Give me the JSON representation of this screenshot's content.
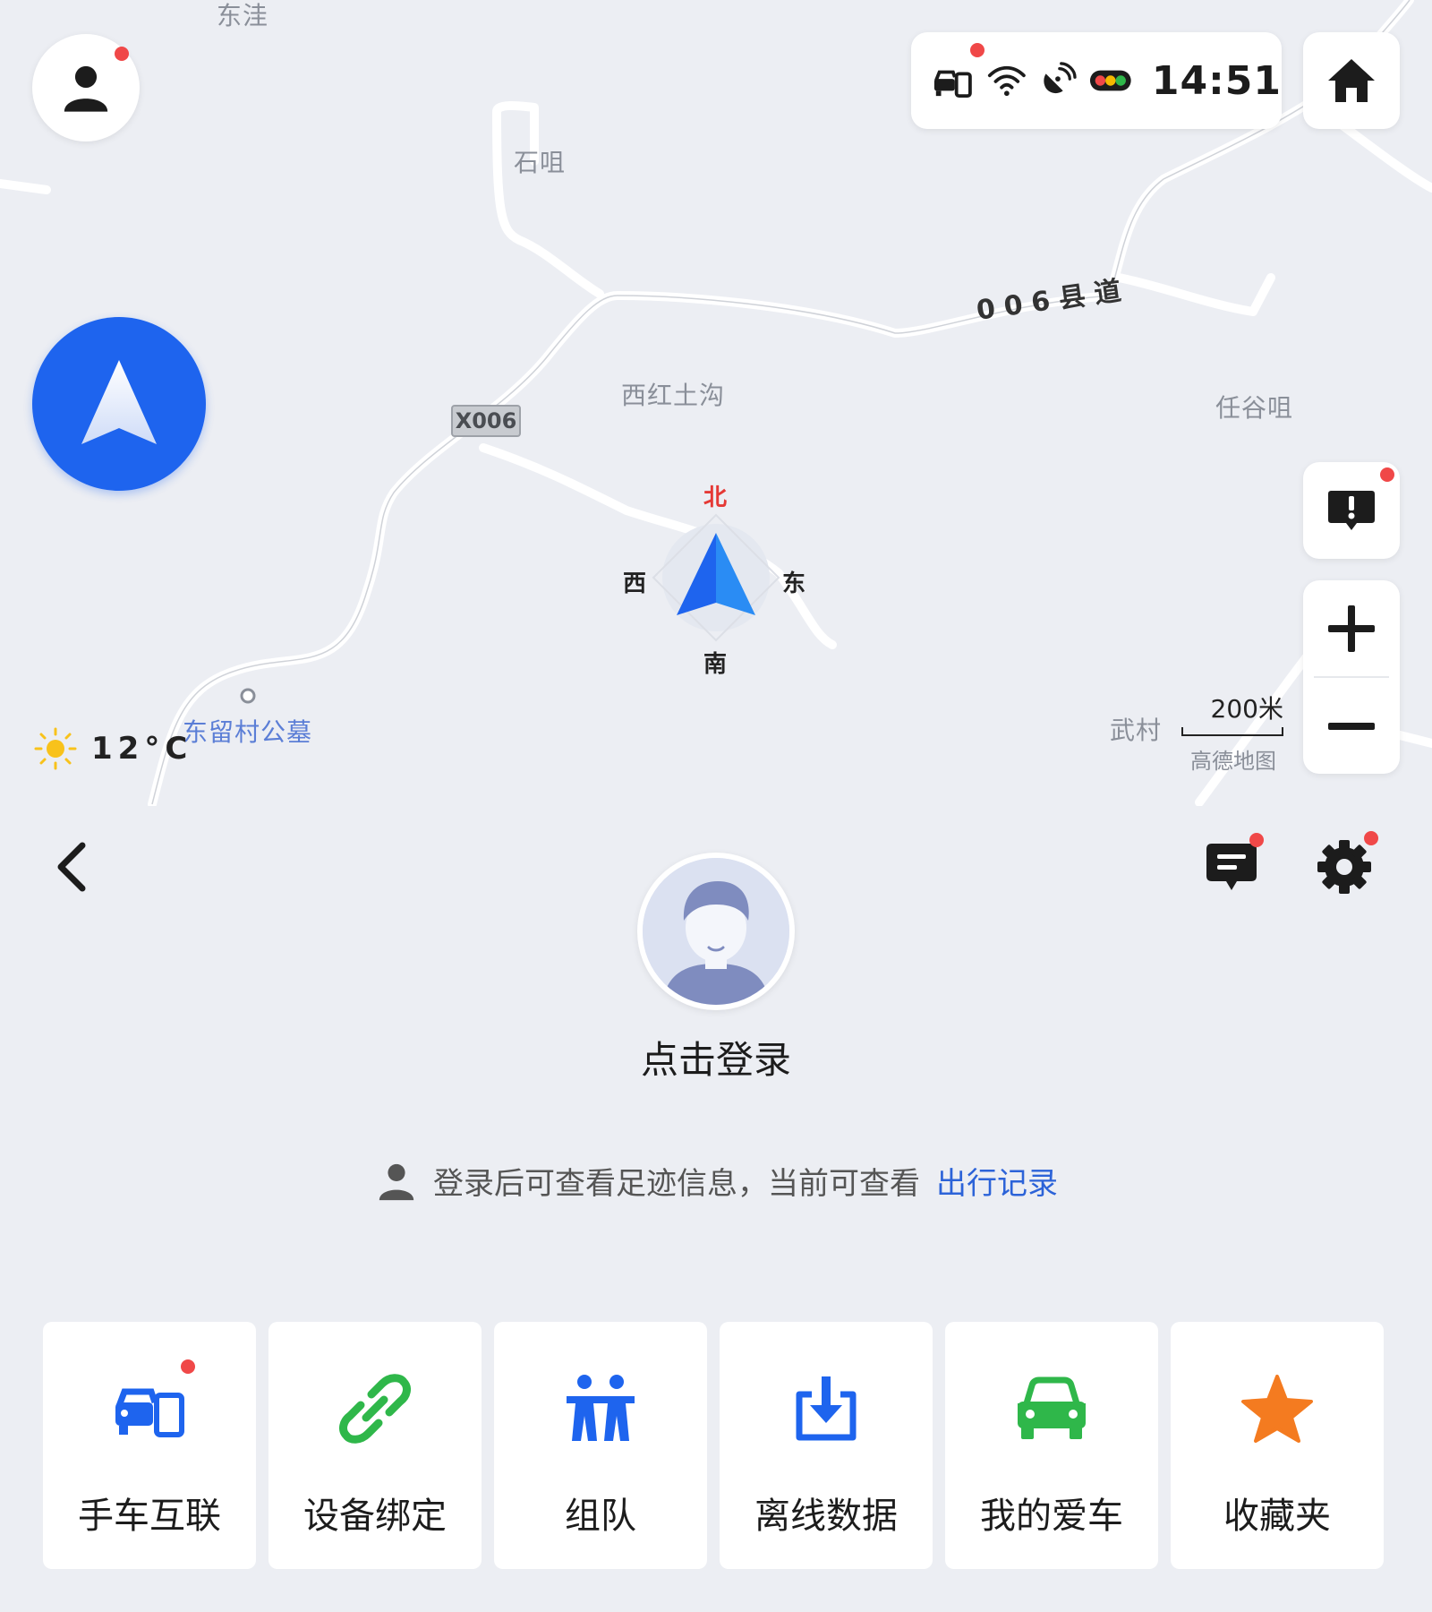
{
  "map": {
    "places": {
      "dongwa": "东洼",
      "shiju": "石咀",
      "xihongtugou": "西红土沟",
      "renguju": "任谷咀",
      "dongliucun": "东留村公墓",
      "wucun": "武村"
    },
    "road_label": "006县道",
    "road_badge": "X006",
    "compass": {
      "north": "北",
      "south": "南",
      "west": "西",
      "east": "东"
    },
    "weather": {
      "icon": "sun-icon",
      "temperature": "12°C"
    },
    "scale": {
      "label": "200米",
      "brand": "高德地图"
    },
    "status": {
      "time": "14:51",
      "icons": [
        "phone-car-link-icon",
        "wifi-icon",
        "gps-signal-icon",
        "traffic-light-icon"
      ]
    }
  },
  "panel": {
    "login_title": "点击登录",
    "hint_text": "登录后可查看足迹信息，当前可查看",
    "hint_link": "出行记录",
    "tiles": [
      {
        "label": "手车互联",
        "icon": "phone-car-icon",
        "color": "#1e64ee",
        "badge": true
      },
      {
        "label": "设备绑定",
        "icon": "link-icon",
        "color": "#2fb74a",
        "badge": false
      },
      {
        "label": "组队",
        "icon": "team-icon",
        "color": "#1e64ee",
        "badge": false
      },
      {
        "label": "离线数据",
        "icon": "download-icon",
        "color": "#1e64ee",
        "badge": false
      },
      {
        "label": "我的爱车",
        "icon": "car-icon",
        "color": "#2fb74a",
        "badge": false
      },
      {
        "label": "收藏夹",
        "icon": "star-icon",
        "color": "#f47b20",
        "badge": false
      }
    ]
  },
  "colors": {
    "accent": "#1e64ee",
    "badge_red": "#f04848",
    "link": "#2c63d8"
  }
}
